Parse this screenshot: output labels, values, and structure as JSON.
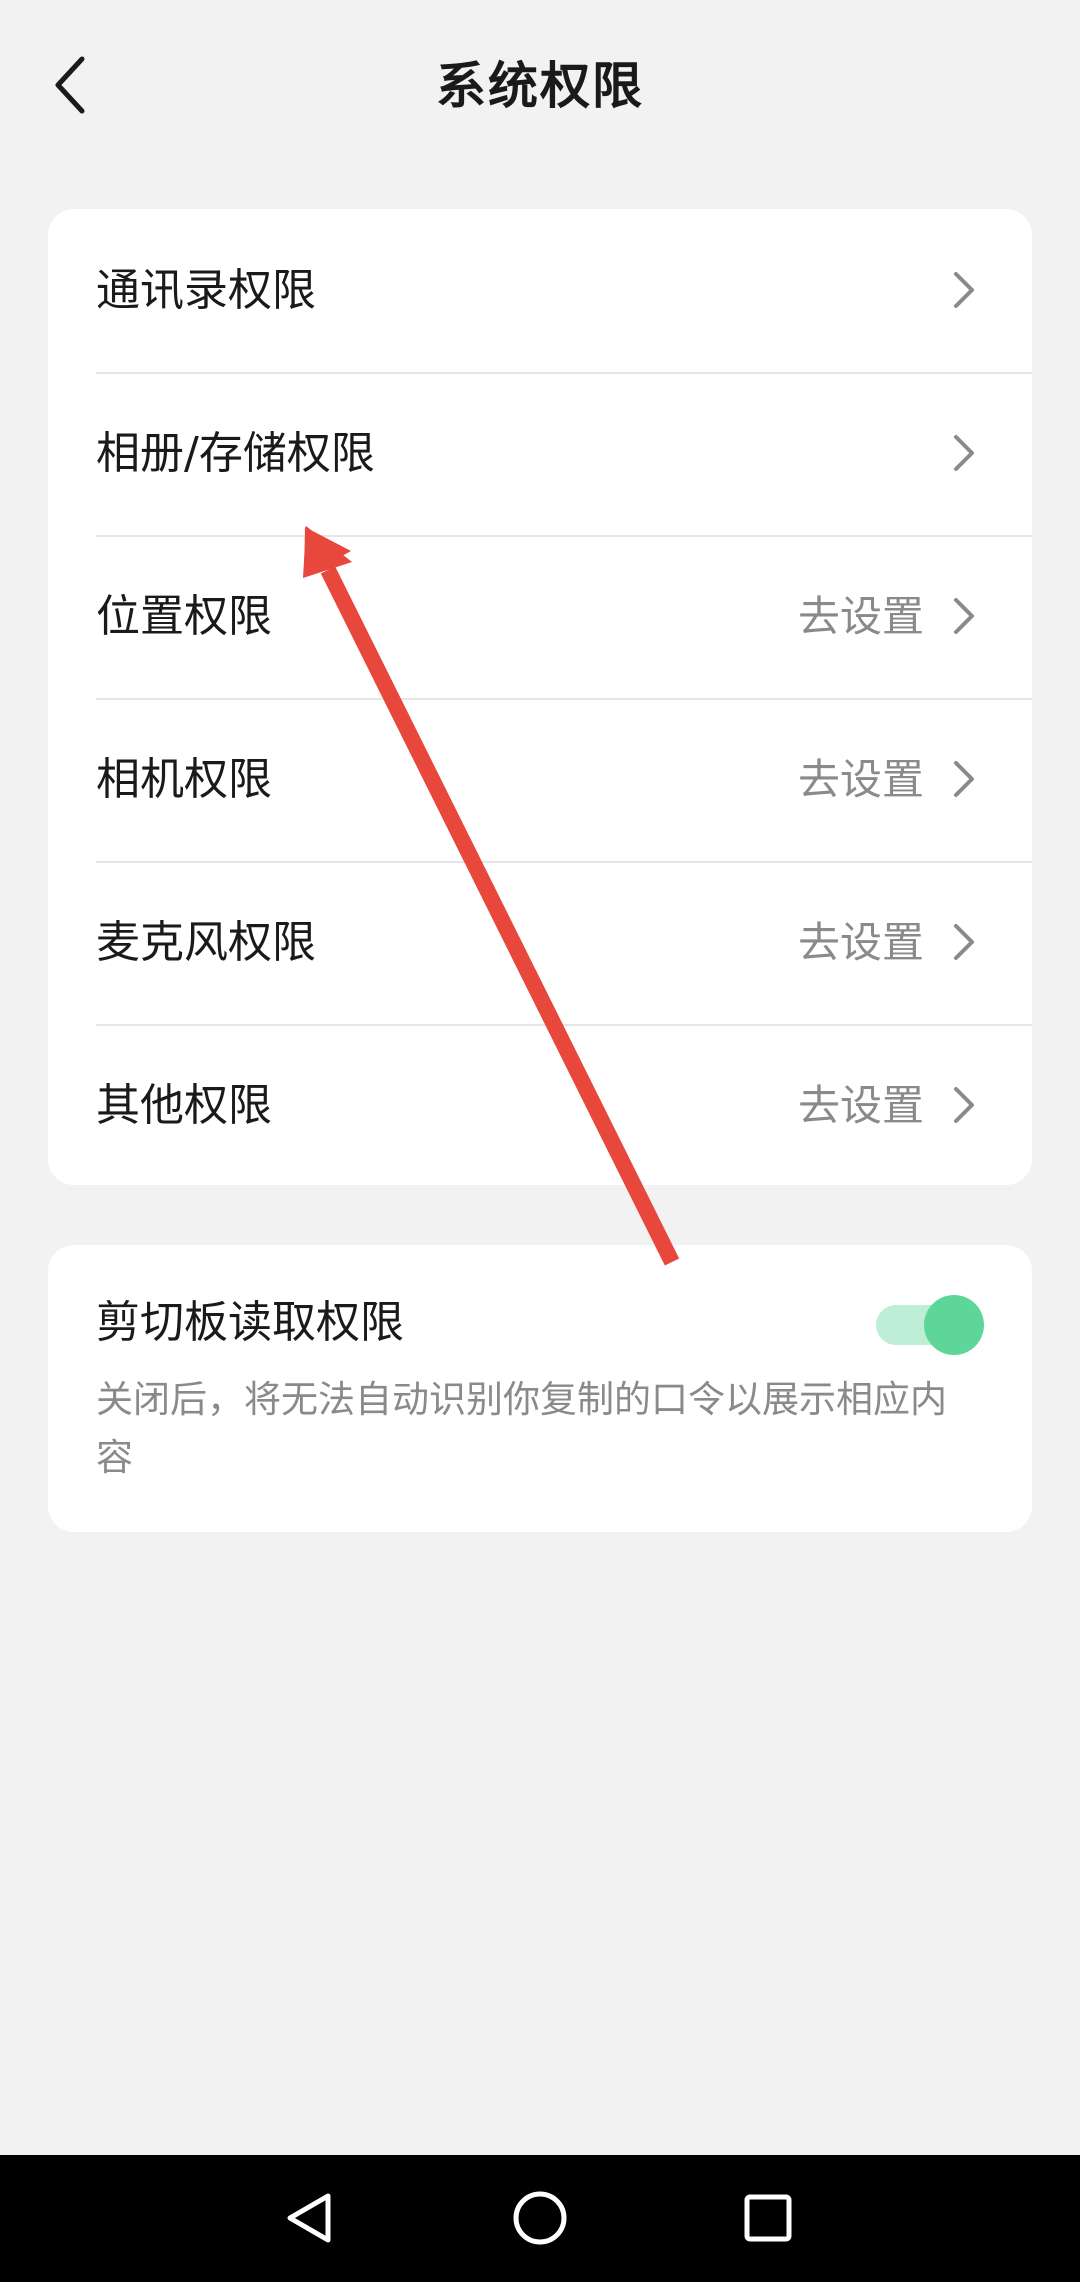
{
  "header": {
    "title": "系统权限",
    "back_icon": "chevron-left-icon"
  },
  "permissions": [
    {
      "label": "通讯录权限",
      "status": "",
      "icon": "chevron-right-icon"
    },
    {
      "label": "相册/存储权限",
      "status": "",
      "icon": "chevron-right-icon"
    },
    {
      "label": "位置权限",
      "status": "去设置",
      "icon": "chevron-right-icon"
    },
    {
      "label": "相机权限",
      "status": "去设置",
      "icon": "chevron-right-icon"
    },
    {
      "label": "麦克风权限",
      "status": "去设置",
      "icon": "chevron-right-icon"
    },
    {
      "label": "其他权限",
      "status": "去设置",
      "icon": "chevron-right-icon"
    }
  ],
  "clipboard": {
    "title": "剪切板读取权限",
    "description": "关闭后，将无法自动识别你复制的口令以展示相应内容",
    "enabled": true
  },
  "annotation": {
    "type": "arrow",
    "color": "#e8473c",
    "points_to": "相册/存储权限"
  },
  "colors": {
    "background": "#f2f2f2",
    "card": "#ffffff",
    "toggle_on": "#5ed69a",
    "secondary_text": "#8a8a8a"
  },
  "system_nav": {
    "back_icon": "triangle-back-icon",
    "home_icon": "circle-home-icon",
    "recents_icon": "square-recents-icon"
  }
}
